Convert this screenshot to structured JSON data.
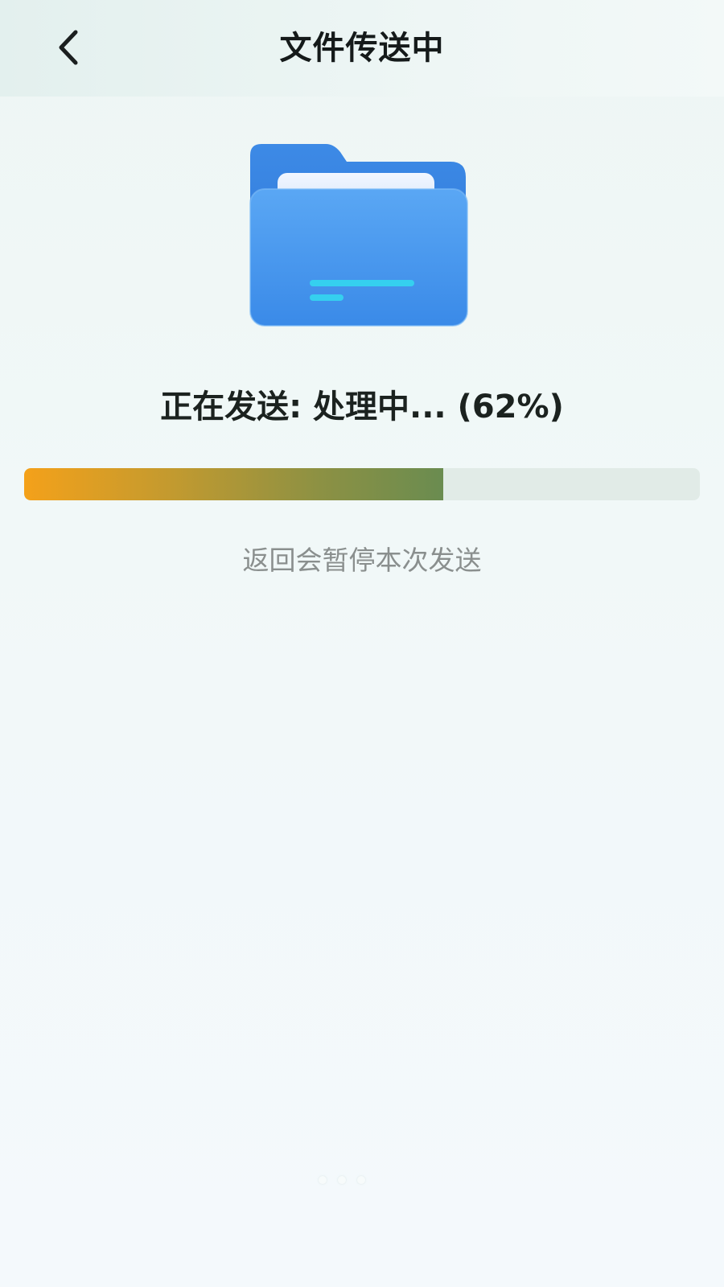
{
  "header": {
    "title": "文件传送中",
    "back_icon": "chevron-left-icon"
  },
  "transfer": {
    "folder_icon": "folder-icon",
    "status_text": "正在发送: 处理中... (62%)",
    "progress_fraction": 0.62,
    "hint": "返回会暂停本次发送"
  },
  "colors": {
    "progress_start": "#f4a11a",
    "progress_end": "#6a8c50",
    "track": "#e1ebe7",
    "folder": "#3f8fe6"
  }
}
